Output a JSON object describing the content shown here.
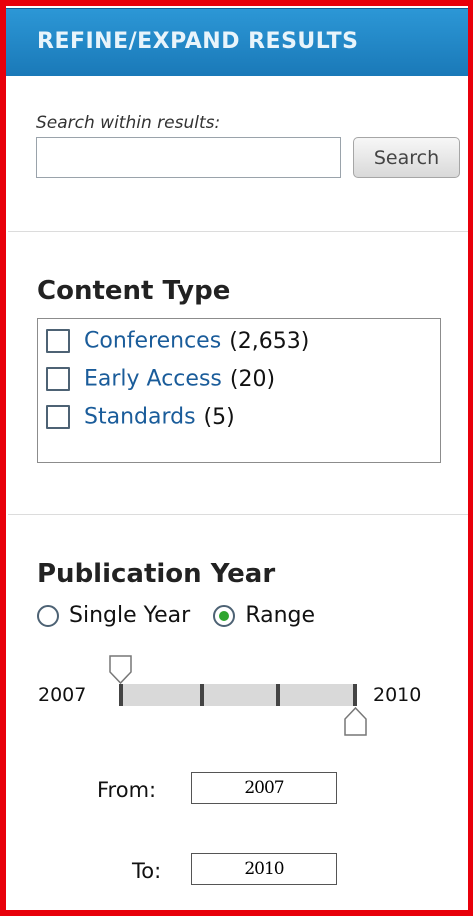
{
  "header": {
    "title": "REFINE/EXPAND RESULTS"
  },
  "search": {
    "label": "Search within results:",
    "value": "",
    "placeholder": "",
    "button_label": "Search"
  },
  "content_type": {
    "title": "Content Type",
    "items": [
      {
        "label": "Conferences",
        "count": "(2,653)",
        "checked": false
      },
      {
        "label": "Early Access",
        "count": "(20)",
        "checked": false
      },
      {
        "label": "Standards",
        "count": "(5)",
        "checked": false
      }
    ]
  },
  "publication_year": {
    "title": "Publication Year",
    "mode_options": [
      {
        "label": "Single Year",
        "selected": false
      },
      {
        "label": "Range",
        "selected": true
      }
    ],
    "slider": {
      "min": "2007",
      "max": "2010",
      "from": 2007,
      "to": 2010
    },
    "from_label": "From:",
    "from_value": "2007",
    "to_label": "To:",
    "to_value": "2010"
  },
  "colors": {
    "header": "#1e87c8",
    "frame": "#e8000b",
    "link": "#1a5c9a",
    "radio_on": "#2ea52e"
  }
}
